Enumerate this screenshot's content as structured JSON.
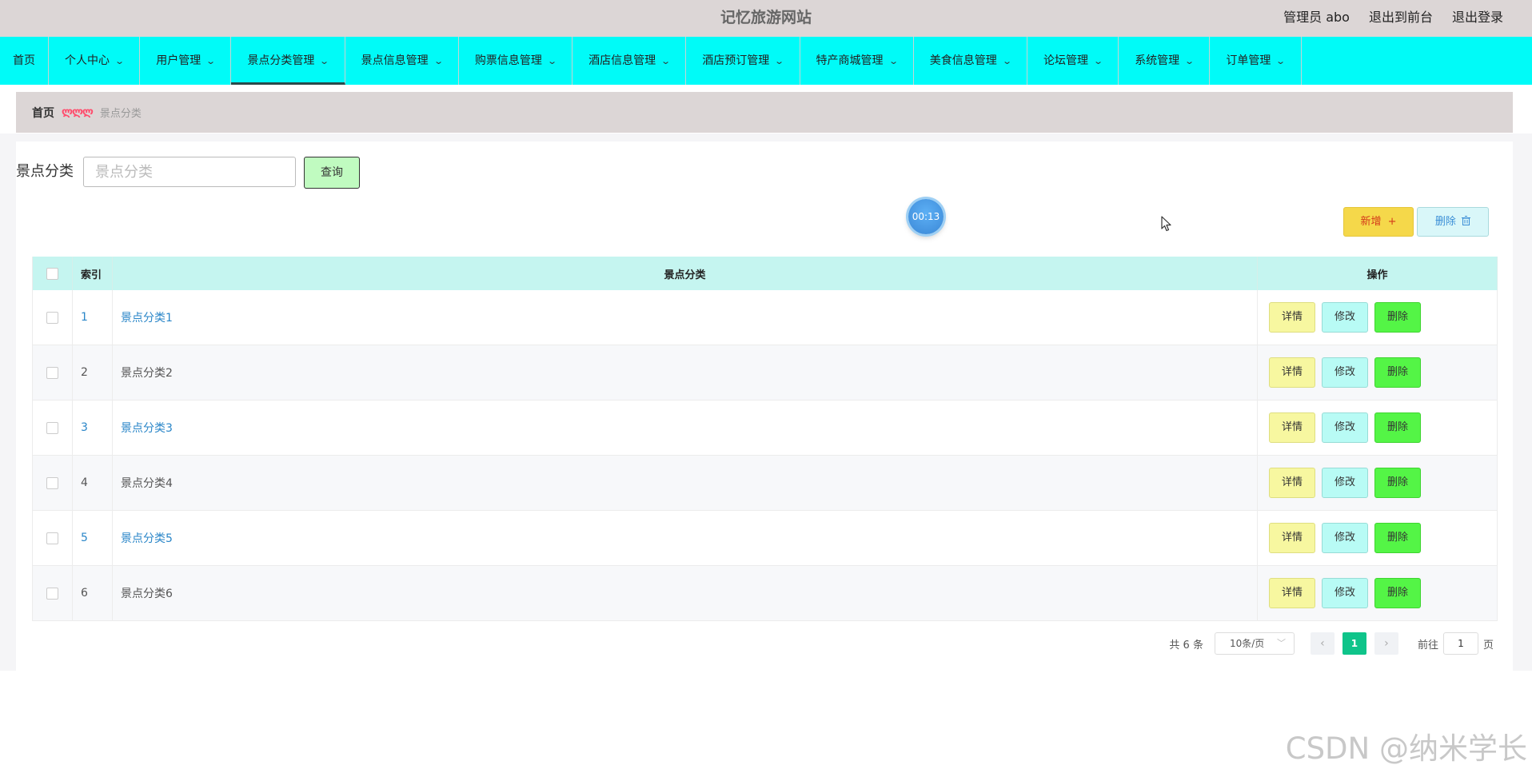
{
  "header": {
    "site_title": "记忆旅游网站",
    "user": "管理员 abo",
    "to_front": "退出到前台",
    "logout": "退出登录"
  },
  "nav": {
    "home": "首页",
    "items": [
      {
        "label": "个人中心"
      },
      {
        "label": "用户管理"
      },
      {
        "label": "景点分类管理",
        "active": true
      },
      {
        "label": "景点信息管理"
      },
      {
        "label": "购票信息管理"
      },
      {
        "label": "酒店信息管理"
      },
      {
        "label": "酒店预订管理"
      },
      {
        "label": "特产商城管理"
      },
      {
        "label": "美食信息管理"
      },
      {
        "label": "论坛管理"
      },
      {
        "label": "系统管理"
      },
      {
        "label": "订单管理"
      }
    ]
  },
  "breadcrumb": {
    "home": "首页",
    "separator": "ლლლ",
    "current": "景点分类"
  },
  "search": {
    "label": "景点分类",
    "placeholder": "景点分类",
    "value": "",
    "button": "查询"
  },
  "timer": "00:13",
  "actions": {
    "add": "新增",
    "add_icon": "plus-icon",
    "delete": "删除",
    "delete_icon": "trash-icon"
  },
  "table": {
    "headers": {
      "index": "索引",
      "category": "景点分类",
      "ops": "操作"
    },
    "rows": [
      {
        "index": "1",
        "category": "景点分类1",
        "highlight": true
      },
      {
        "index": "2",
        "category": "景点分类2",
        "highlight": false
      },
      {
        "index": "3",
        "category": "景点分类3",
        "highlight": true
      },
      {
        "index": "4",
        "category": "景点分类4",
        "highlight": false
      },
      {
        "index": "5",
        "category": "景点分类5",
        "highlight": true
      },
      {
        "index": "6",
        "category": "景点分类6",
        "highlight": false
      }
    ],
    "row_buttons": {
      "detail": "详情",
      "edit": "修改",
      "delete": "删除"
    }
  },
  "pagination": {
    "total": "共 6 条",
    "page_size": "10条/页",
    "current_page": "1",
    "goto_label": "前往",
    "goto_value": "1",
    "page_suffix": "页"
  },
  "watermark": "CSDN @纳米学长",
  "colors": {
    "nav_bg": "#00fbf8",
    "header_bg": "#dcd6d6",
    "table_header_bg": "#c5f5f0",
    "link": "#2a86c8",
    "pager_active": "#0fc48a"
  }
}
